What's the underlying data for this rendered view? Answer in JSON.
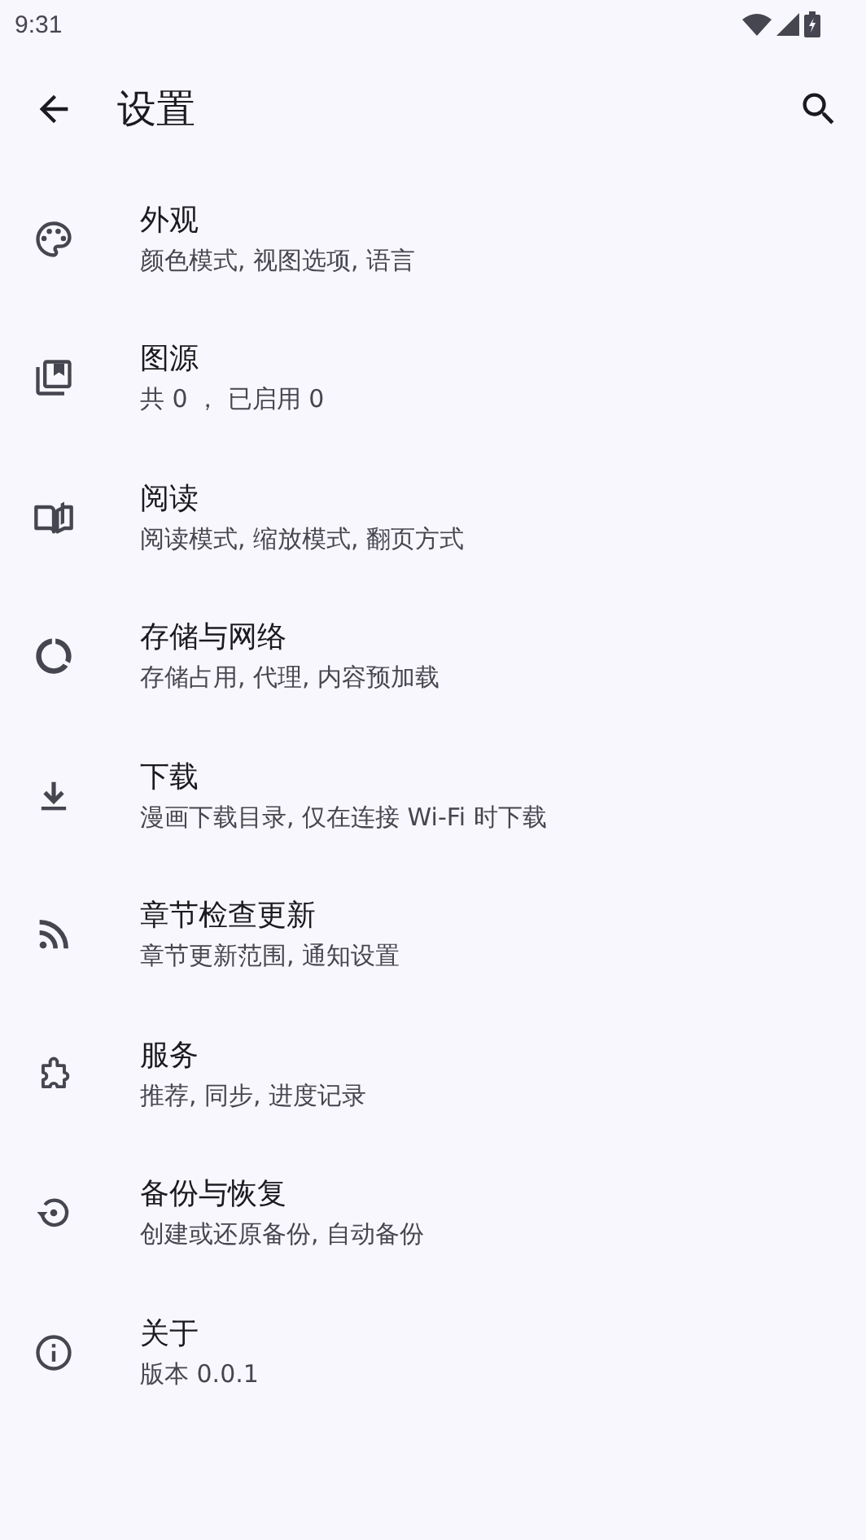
{
  "status_bar": {
    "time": "9:31"
  },
  "app_bar": {
    "title": "设置"
  },
  "items": [
    {
      "title": "外观",
      "subtitle": "颜色模式, 视图选项, 语言"
    },
    {
      "title": "图源",
      "subtitle": "共 0 ， 已启用 0"
    },
    {
      "title": "阅读",
      "subtitle": "阅读模式, 缩放模式, 翻页方式"
    },
    {
      "title": "存储与网络",
      "subtitle": "存储占用, 代理, 内容预加载"
    },
    {
      "title": "下载",
      "subtitle": "漫画下载目录, 仅在连接 Wi-Fi 时下载"
    },
    {
      "title": "章节检查更新",
      "subtitle": "章节更新范围, 通知设置"
    },
    {
      "title": "服务",
      "subtitle": "推荐, 同步, 进度记录"
    },
    {
      "title": "备份与恢复",
      "subtitle": "创建或还原备份, 自动备份"
    },
    {
      "title": "关于",
      "subtitle": "版本 0.0.1"
    }
  ]
}
